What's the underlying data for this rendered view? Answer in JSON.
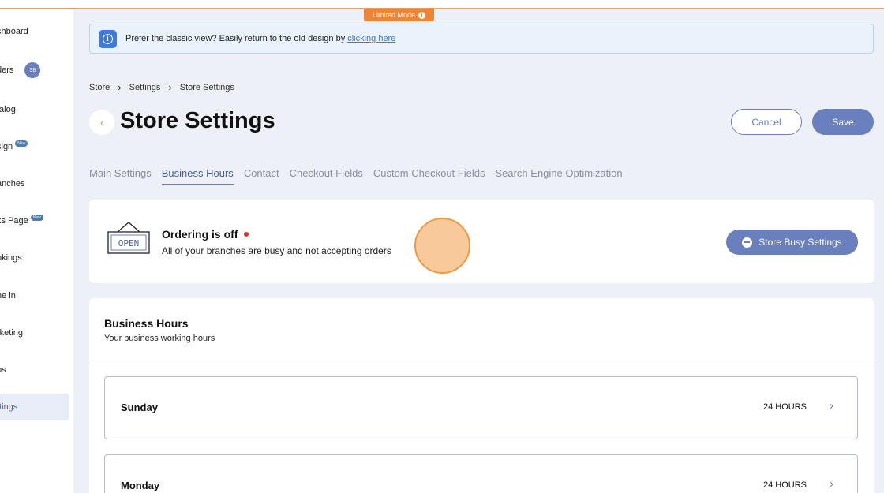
{
  "top_badge": {
    "label": "Limited Mode",
    "icon": "info-icon"
  },
  "sidebar": {
    "items": [
      {
        "label": "shboard"
      },
      {
        "label": "ders",
        "badge": "38"
      },
      {
        "label": "talog"
      },
      {
        "label": "sign",
        "tag": "New"
      },
      {
        "label": "anches"
      },
      {
        "label": "ks Page",
        "tag": "New"
      },
      {
        "label": "okings"
      },
      {
        "label": "ne in"
      },
      {
        "label": "rketing"
      },
      {
        "label": "ps"
      },
      {
        "label": "ttings",
        "active": true
      }
    ]
  },
  "banner": {
    "text": "Prefer the classic view? Easily return to the old design by",
    "link": "clicking here",
    "icon": "info-icon"
  },
  "breadcrumb": [
    "Store",
    "Settings",
    "Store Settings"
  ],
  "page_title": "Store Settings",
  "actions": {
    "cancel": "Cancel",
    "save": "Save"
  },
  "tabs": [
    {
      "label": "Main Settings"
    },
    {
      "label": "Business Hours",
      "active": true
    },
    {
      "label": "Contact"
    },
    {
      "label": "Checkout Fields"
    },
    {
      "label": "Custom Checkout Fields"
    },
    {
      "label": "Search Engine Optimization"
    }
  ],
  "ordering": {
    "sign_text": "OPEN",
    "title": "Ordering is off",
    "subtitle": "All of your branches are busy and not accepting orders",
    "button": "Store Busy Settings"
  },
  "business_hours": {
    "title": "Business Hours",
    "subtitle": "Your business working hours",
    "days": [
      {
        "name": "Sunday",
        "hours": "24 HOURS"
      },
      {
        "name": "Monday",
        "hours": "24 HOURS"
      }
    ]
  },
  "colors": {
    "accent": "#6a7fbd",
    "warning": "#ee8434",
    "status_off": "#d9342b"
  }
}
